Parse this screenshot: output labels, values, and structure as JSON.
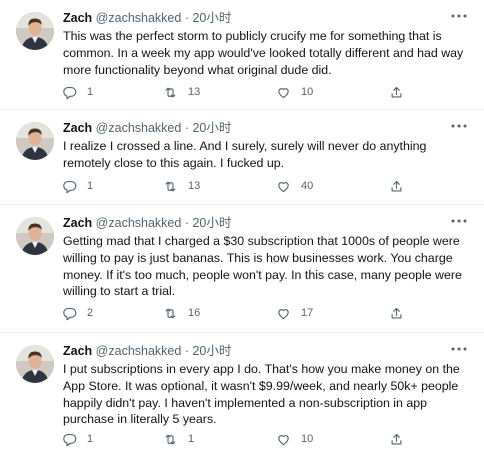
{
  "tweets": [
    {
      "name": "Zach",
      "handle": "@zachshakked",
      "time": "20小时",
      "text": "This was the perfect storm to publicly crucify me for something that is common. In a week my app would've looked totally different and had way more functionality beyond what original dude did.",
      "replies": "1",
      "retweets": "13",
      "likes": "10"
    },
    {
      "name": "Zach",
      "handle": "@zachshakked",
      "time": "20小时",
      "text": "I realize I crossed a line. And I surely, surely will never do anything remotely close to this again. I fucked up.",
      "replies": "1",
      "retweets": "13",
      "likes": "40"
    },
    {
      "name": "Zach",
      "handle": "@zachshakked",
      "time": "20小时",
      "text": "Getting mad that I charged a $30 subscription that 1000s of people were willing to pay is just bananas. This is how businesses work. You charge money. If it's too much, people won't pay. In this case, many people were willing to start a trial.",
      "replies": "2",
      "retweets": "16",
      "likes": "17"
    },
    {
      "name": "Zach",
      "handle": "@zachshakked",
      "time": "20小时",
      "text": "I put subscriptions in every app I do. That's how you make money on the App Store. It was optional, it wasn't $9.99/week, and nearly 50k+ people happily didn't pay. I haven't implemented a non-subscription in app purchase in literally 5 years.",
      "replies": "1",
      "retweets": "1",
      "likes": "10"
    }
  ],
  "icons": {
    "more": "more-icon",
    "reply": "reply-icon",
    "retweet": "retweet-icon",
    "like": "heart-icon",
    "share": "share-icon"
  },
  "colors": {
    "text": "#0f1419",
    "secondary": "#536471",
    "divider": "#eff3f4"
  }
}
